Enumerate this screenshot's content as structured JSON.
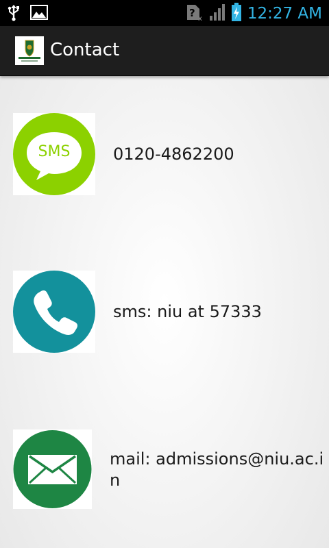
{
  "status_bar": {
    "time": "12:27 AM",
    "icons": [
      "usb-icon",
      "image-icon",
      "no-sim-icon",
      "signal-icon",
      "battery-charging-icon"
    ]
  },
  "action_bar": {
    "title": "Contact",
    "logo_icon": "university-crest-icon"
  },
  "contacts": [
    {
      "icon": "sms-icon",
      "icon_color": "#8cd100",
      "text": "0120-4862200"
    },
    {
      "icon": "phone-icon",
      "icon_color": "#13919c",
      "text": "sms: niu at 57333"
    },
    {
      "icon": "mail-icon",
      "icon_color": "#1e8644",
      "text": "mail: admissions@niu.ac.in"
    }
  ]
}
